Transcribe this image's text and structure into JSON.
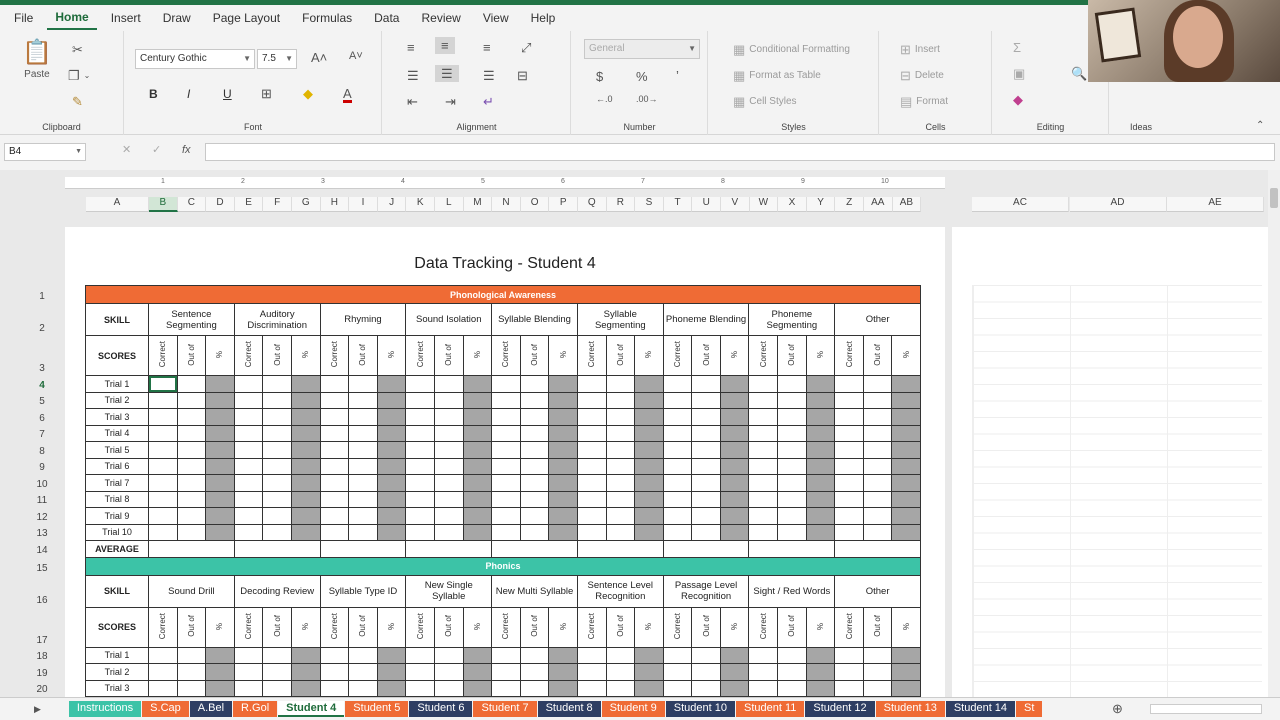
{
  "menu": [
    "File",
    "Home",
    "Insert",
    "Draw",
    "Page Layout",
    "Formulas",
    "Data",
    "Review",
    "View",
    "Help"
  ],
  "ribbon": {
    "clipboard": {
      "paste": "Paste",
      "label": "Clipboard"
    },
    "font": {
      "name": "Century Gothic",
      "size": "7.5",
      "label": "Font",
      "bold": "B",
      "italic": "I",
      "underline": "U"
    },
    "alignment": {
      "label": "Alignment"
    },
    "number": {
      "format": "General",
      "label": "Number",
      "currency": "$",
      "percent": "%"
    },
    "styles": {
      "conditional": "Conditional Formatting",
      "table": "Format as Table",
      "cell": "Cell Styles",
      "label": "Styles"
    },
    "cells": {
      "insert": "Insert",
      "delete": "Delete",
      "format": "Format",
      "label": "Cells"
    },
    "editing": {
      "label": "Editing"
    },
    "ideas": {
      "label": "Ideas"
    }
  },
  "formula_bar": {
    "name_box": "B4",
    "fx": "fx",
    "value": ""
  },
  "columns": [
    "A",
    "B",
    "C",
    "D",
    "E",
    "F",
    "G",
    "H",
    "I",
    "J",
    "K",
    "L",
    "M",
    "N",
    "O",
    "P",
    "Q",
    "R",
    "S",
    "T",
    "U",
    "V",
    "W",
    "X",
    "Y",
    "Z",
    "AA",
    "AB"
  ],
  "far_columns": [
    "AC",
    "AD",
    "AE"
  ],
  "ruler": [
    "1",
    "2",
    "3",
    "4",
    "5",
    "6",
    "7",
    "8",
    "9",
    "10"
  ],
  "rows": [
    "1",
    "2",
    "3",
    "4",
    "5",
    "6",
    "7",
    "8",
    "9",
    "10",
    "11",
    "12",
    "13",
    "14",
    "15",
    "16",
    "17",
    "18",
    "19",
    "20"
  ],
  "sheet": {
    "title": "Data Tracking - Student 4",
    "skill_label": "SKILL",
    "scores_label": "SCORES",
    "average_label": "AVERAGE",
    "score_cols": [
      "Correct",
      "Out of",
      "%"
    ],
    "sections": [
      {
        "name": "Phonological Awareness",
        "color": "#ef6b35",
        "skills": [
          "Sentence Segmenting",
          "Auditory Discrimination",
          "Rhyming",
          "Sound Isolation",
          "Syllable Blending",
          "Syllable Segmenting",
          "Phoneme Blending",
          "Phoneme Segmenting",
          "Other"
        ],
        "trials": [
          "Trial 1",
          "Trial 2",
          "Trial 3",
          "Trial 4",
          "Trial 5",
          "Trial 6",
          "Trial 7",
          "Trial 8",
          "Trial 9",
          "Trial 10"
        ]
      },
      {
        "name": "Phonics",
        "color": "#3cc3a7",
        "skills": [
          "Sound Drill",
          "Decoding Review",
          "Syllable Type ID",
          "New Single Syllable",
          "New Multi Syllable",
          "Sentence Level Recognition",
          "Passage Level Recognition",
          "Sight / Red Words",
          "Other"
        ],
        "trials": [
          "Trial 1",
          "Trial 2",
          "Trial 3"
        ]
      }
    ]
  },
  "tabs": [
    {
      "label": "Instructions",
      "color": "#3cc3a7"
    },
    {
      "label": "S.Cap",
      "color": "#ef6b35"
    },
    {
      "label": "A.Bel",
      "color": "#2e3e63"
    },
    {
      "label": "R.Gol",
      "color": "#ef6b35"
    },
    {
      "label": "Student 4",
      "color": "#ffffff",
      "active": true
    },
    {
      "label": "Student 5",
      "color": "#ef6b35"
    },
    {
      "label": "Student 6",
      "color": "#2e3e63"
    },
    {
      "label": "Student 7",
      "color": "#ef6b35"
    },
    {
      "label": "Student 8",
      "color": "#2e3e63"
    },
    {
      "label": "Student 9",
      "color": "#ef6b35"
    },
    {
      "label": "Student 10",
      "color": "#2e3e63"
    },
    {
      "label": "Student 11",
      "color": "#ef6b35"
    },
    {
      "label": "Student 12",
      "color": "#2e3e63"
    },
    {
      "label": "Student 13",
      "color": "#ef6b35"
    },
    {
      "label": "Student 14",
      "color": "#2e3e63"
    },
    {
      "label": "St",
      "color": "#ef6b35"
    }
  ]
}
